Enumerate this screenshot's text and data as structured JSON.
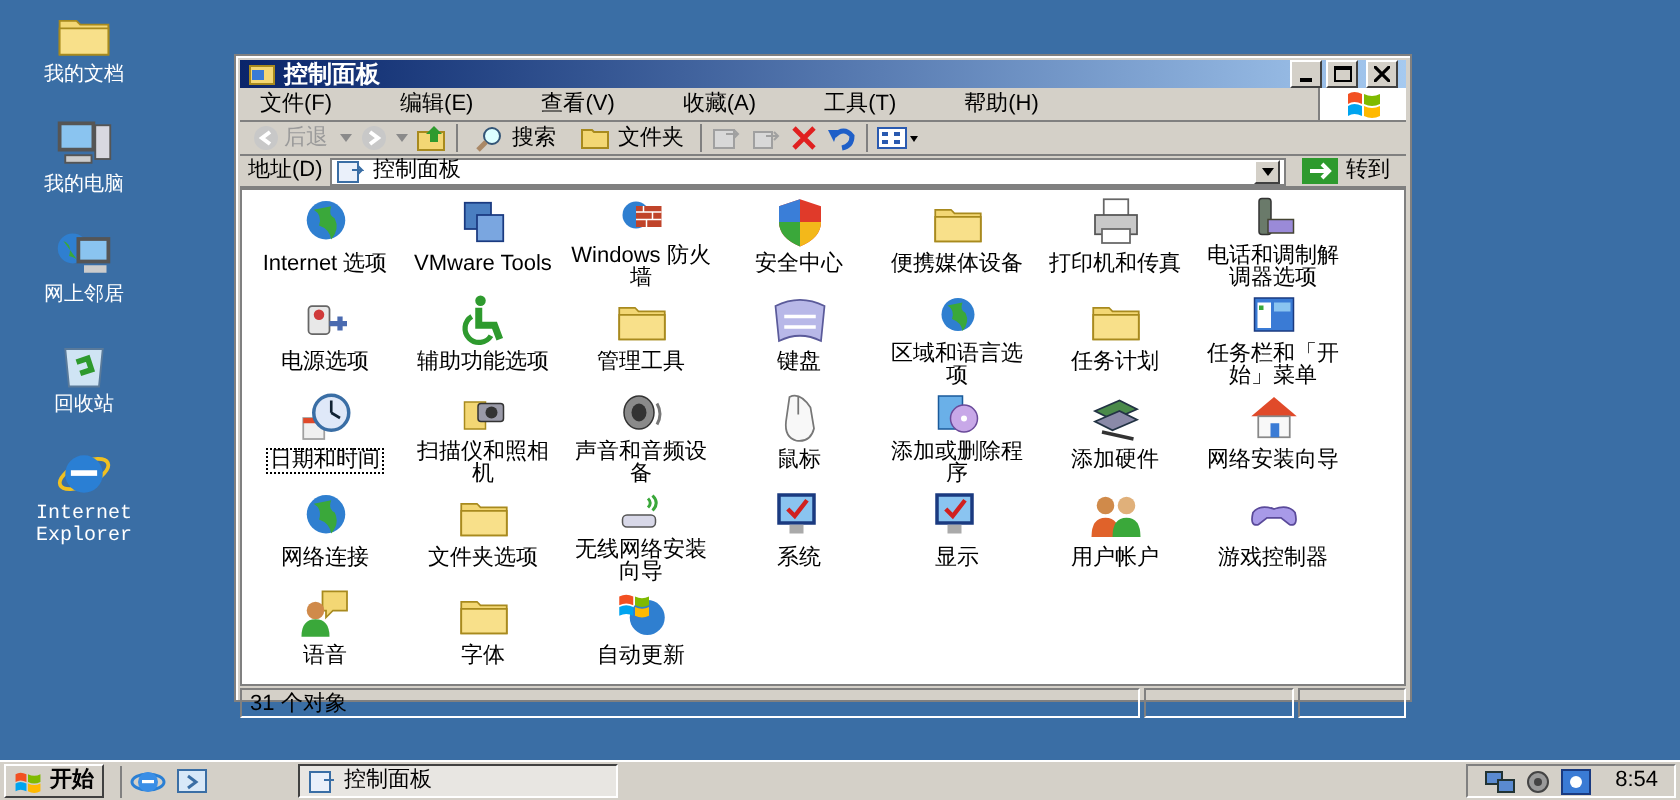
{
  "desktop_icons": [
    {
      "label": "我的文档"
    },
    {
      "label": "我的电脑"
    },
    {
      "label": "网上邻居"
    },
    {
      "label": "回收站"
    },
    {
      "label": "Internet Explorer"
    }
  ],
  "window": {
    "title": "控制面板",
    "menu": [
      "文件(F)",
      "编辑(E)",
      "查看(V)",
      "收藏(A)",
      "工具(T)",
      "帮助(H)"
    ],
    "toolbar": {
      "back": {
        "label": "后退",
        "disabled": true
      },
      "search": "搜索",
      "folders": "文件夹"
    },
    "address": {
      "label": "地址(D)",
      "value": "控制面板",
      "go": "转到"
    },
    "items": [
      {
        "label": "Internet 选项",
        "selected": false
      },
      {
        "label": "VMware Tools",
        "selected": false
      },
      {
        "label": "Windows 防火墙",
        "selected": false
      },
      {
        "label": "安全中心",
        "selected": false
      },
      {
        "label": "便携媒体设备",
        "selected": false
      },
      {
        "label": "打印机和传真",
        "selected": false
      },
      {
        "label": "电话和调制解调器选项",
        "selected": false
      },
      {
        "label": "电源选项",
        "selected": false
      },
      {
        "label": "辅助功能选项",
        "selected": false
      },
      {
        "label": "管理工具",
        "selected": false
      },
      {
        "label": "键盘",
        "selected": false
      },
      {
        "label": "区域和语言选项",
        "selected": false
      },
      {
        "label": "任务计划",
        "selected": false
      },
      {
        "label": "任务栏和「开始」菜单",
        "selected": false
      },
      {
        "label": "日期和时间",
        "selected": true
      },
      {
        "label": "扫描仪和照相机",
        "selected": false
      },
      {
        "label": "声音和音频设备",
        "selected": false
      },
      {
        "label": "鼠标",
        "selected": false
      },
      {
        "label": "添加或删除程序",
        "selected": false
      },
      {
        "label": "添加硬件",
        "selected": false
      },
      {
        "label": "网络安装向导",
        "selected": false
      },
      {
        "label": "网络连接",
        "selected": false
      },
      {
        "label": "文件夹选项",
        "selected": false
      },
      {
        "label": "无线网络安装向导",
        "selected": false
      },
      {
        "label": "系统",
        "selected": false
      },
      {
        "label": "显示",
        "selected": false
      },
      {
        "label": "用户帐户",
        "selected": false
      },
      {
        "label": "游戏控制器",
        "selected": false
      },
      {
        "label": "语音",
        "selected": false
      },
      {
        "label": "字体",
        "selected": false
      },
      {
        "label": "自动更新",
        "selected": false
      }
    ],
    "status_bar": [
      "31 个对象"
    ]
  },
  "taskbar": {
    "start": "开始",
    "tasks": [
      {
        "label": "控制面板",
        "selected": true
      }
    ],
    "clock": "8:54"
  }
}
